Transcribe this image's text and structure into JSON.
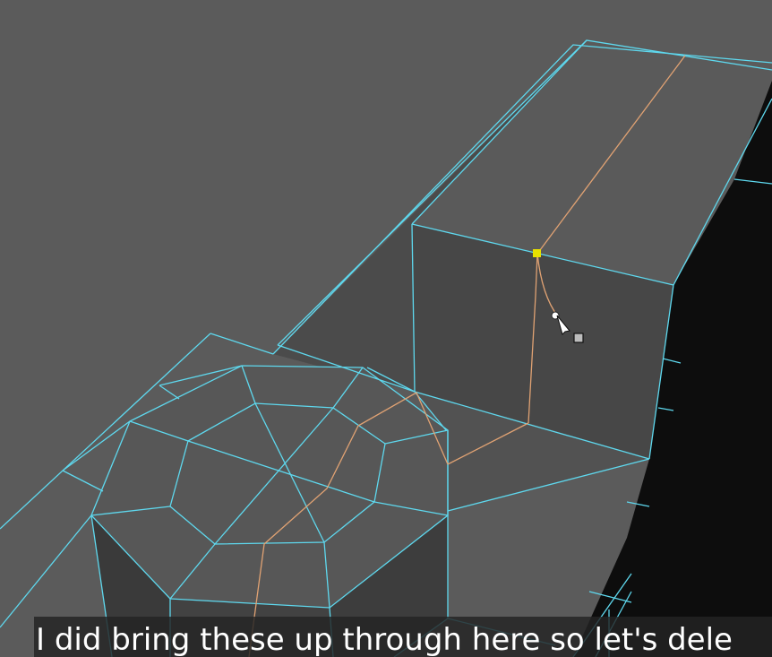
{
  "viewport": {
    "background": "#5b5b5b",
    "wire_color": "#5ed8ee",
    "selected_edge_color": "#e0a273",
    "selected_vertex_color": "#e8e000"
  },
  "cursor": {
    "icon": "multi-cut-tool-cursor-icon"
  },
  "caption": {
    "text": "I did bring these up through here so let's dele"
  }
}
